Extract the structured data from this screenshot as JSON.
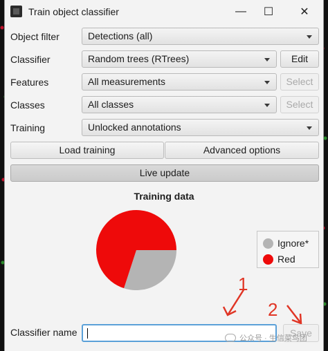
{
  "window": {
    "title": "Train object classifier",
    "controls": {
      "minimize": "—",
      "maximize": "☐",
      "close": "✕"
    }
  },
  "form": {
    "object_filter": {
      "label": "Object filter",
      "value": "Detections (all)"
    },
    "classifier": {
      "label": "Classifier",
      "value": "Random trees (RTrees)",
      "button": "Edit"
    },
    "features": {
      "label": "Features",
      "value": "All measurements",
      "button": "Select"
    },
    "classes": {
      "label": "Classes",
      "value": "All classes",
      "button": "Select"
    },
    "training": {
      "label": "Training",
      "value": "Unlocked annotations"
    }
  },
  "buttons": {
    "load_training": "Load training",
    "advanced_options": "Advanced options",
    "live_update": "Live update",
    "save": "Save"
  },
  "chart_data": {
    "type": "pie",
    "title": "Training data",
    "categories": [
      "Ignore*",
      "Red"
    ],
    "values": [
      30,
      70
    ],
    "colors": [
      "#b4b4b4",
      "#ee0a0a"
    ],
    "legend_placement": "right"
  },
  "classifier_name": {
    "label": "Classifier name",
    "value": ""
  },
  "annotations": {
    "first": "1",
    "second": "2",
    "color": "#e03525"
  },
  "watermark": {
    "text": "公众号 · 生信菜鸟团"
  }
}
